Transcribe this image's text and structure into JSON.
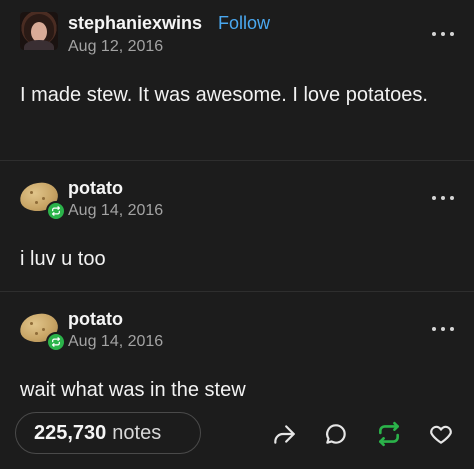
{
  "original_post": {
    "username": "stephaniexwins",
    "follow_label": "Follow",
    "date": "Aug 12, 2016",
    "text": "I made stew. It was awesome. I love potatoes."
  },
  "reblog_1": {
    "username": "potato",
    "date": "Aug 14, 2016",
    "text": "i luv u too"
  },
  "reblog_2": {
    "username": "potato",
    "date": "Aug 14, 2016",
    "text": "wait what was in the stew"
  },
  "footer": {
    "notes_count": "225,730",
    "notes_label": "notes"
  },
  "icons": {
    "more": "more-horizontal-icon",
    "share": "share-icon",
    "reply": "reply-icon",
    "reblog": "reblog-icon",
    "like": "heart-icon"
  },
  "colors": {
    "background": "#1c1c1c",
    "follow": "#4aa8f0",
    "reblog_green": "#2bb34a",
    "muted_text": "#a3a3a3"
  }
}
